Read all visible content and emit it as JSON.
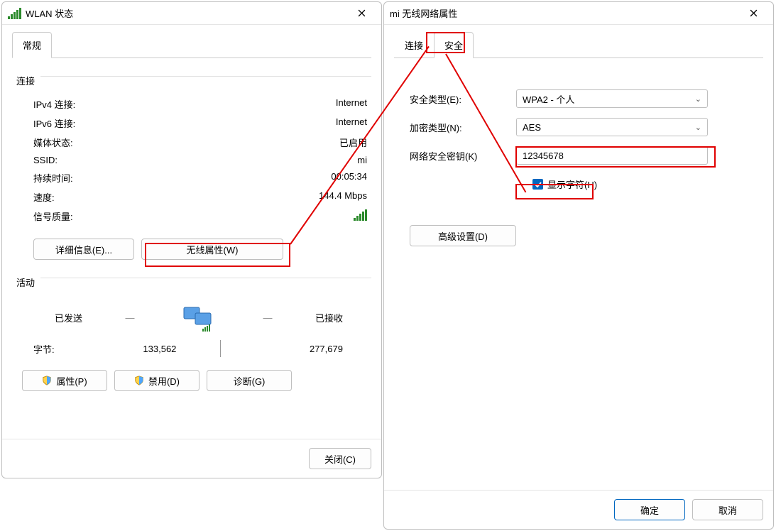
{
  "left": {
    "title": "WLAN 状态",
    "tabs": {
      "general": "常规"
    },
    "section_connection": "连接",
    "ipv4_label": "IPv4 连接:",
    "ipv4_value": "Internet",
    "ipv6_label": "IPv6 连接:",
    "ipv6_value": "Internet",
    "media_label": "媒体状态:",
    "media_value": "已启用",
    "ssid_label": "SSID:",
    "ssid_value": "mi",
    "duration_label": "持续时间:",
    "duration_value": "00:05:34",
    "speed_label": "速度:",
    "speed_value": "144.4 Mbps",
    "signal_label": "信号质量:",
    "details_btn": "详细信息(E)...",
    "wireless_btn": "无线属性(W)",
    "section_activity": "活动",
    "sent_label": "已发送",
    "recv_label": "已接收",
    "bytes_label": "字节:",
    "sent_bytes": "133,562",
    "recv_bytes": "277,679",
    "props_btn": "属性(P)",
    "disable_btn": "禁用(D)",
    "diag_btn": "诊断(G)",
    "close_btn": "关闭(C)"
  },
  "right": {
    "title": "mi 无线网络属性",
    "tabs": {
      "connection": "连接",
      "security": "安全"
    },
    "sec_type_label": "安全类型(E):",
    "sec_type_value": "WPA2 - 个人",
    "enc_type_label": "加密类型(N):",
    "enc_type_value": "AES",
    "key_label": "网络安全密钥(K)",
    "key_value": "12345678",
    "show_chars": "显示字符(H)",
    "advanced_btn": "高级设置(D)",
    "ok_btn": "确定",
    "cancel_btn": "取消"
  }
}
